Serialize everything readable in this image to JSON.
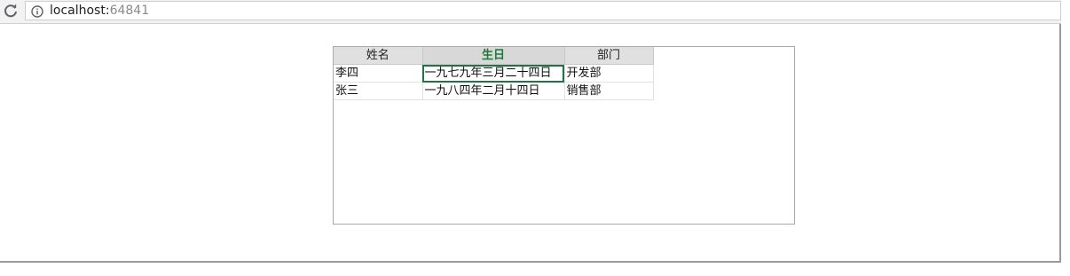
{
  "browser": {
    "url_host": "localhost:",
    "url_port": "64841",
    "reload_icon": "reload-icon",
    "info_icon": "info-icon"
  },
  "grid": {
    "columns": [
      {
        "label": "姓名"
      },
      {
        "label": "生日",
        "selected": true
      },
      {
        "label": "部门"
      }
    ],
    "rows": [
      {
        "name": "李四",
        "birthday": "一九七九年三月二十四日",
        "department": "开发部"
      },
      {
        "name": "张三",
        "birthday": "一九八四年二月十四日",
        "department": "销售部"
      }
    ],
    "active_cell": "row 1, 生日",
    "accent_color": "#217346"
  }
}
